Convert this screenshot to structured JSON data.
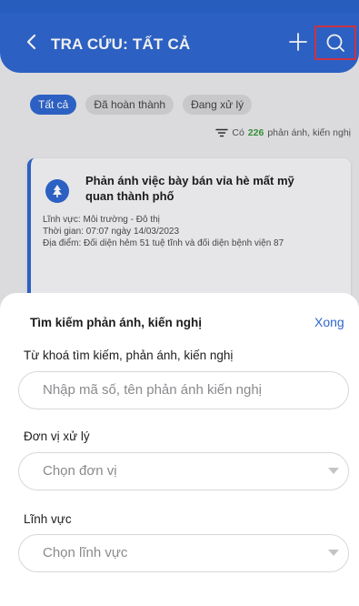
{
  "header": {
    "back_icon": "chevron-left-icon",
    "title": "TRA CỨU: TẤT CẢ",
    "add_icon": "plus-icon",
    "search_icon": "search-icon"
  },
  "filters": {
    "chips": [
      {
        "label": "Tất cả",
        "active": true
      },
      {
        "label": "Đã hoàn thành",
        "active": false
      },
      {
        "label": "Đang xử lý",
        "active": false
      }
    ]
  },
  "summary": {
    "filter_icon": "filter-icon",
    "prefix": "Có",
    "count": "226",
    "suffix": "phản ánh, kiến nghị"
  },
  "card": {
    "icon": "tree-icon",
    "title": "Phản ánh việc bày bán vỉa hè mất mỹ quan thành phố",
    "field": "Lĩnh vực: Môi trường - Đô thị",
    "time": "Thời gian: 07:07 ngày 14/03/2023",
    "location": "Địa điểm: Đối diện hẻm 51 tuệ tĩnh và đối diện bệnh viện 87"
  },
  "sheet": {
    "title": "Tìm kiếm phản ánh, kiến nghị",
    "done_label": "Xong",
    "keyword_label": "Từ khoá tìm kiếm, phản ánh, kiến nghị",
    "keyword_placeholder": "Nhập mã số, tên phản ánh kiến nghị",
    "unit_label": "Đơn vị xử lý",
    "unit_placeholder": "Chọn đơn vị",
    "domain_label": "Lĩnh vực",
    "domain_placeholder": "Chọn lĩnh vực"
  },
  "colors": {
    "primary": "#2f66cf",
    "count_green": "#3a9a3a",
    "highlight_red": "#d9364a"
  }
}
